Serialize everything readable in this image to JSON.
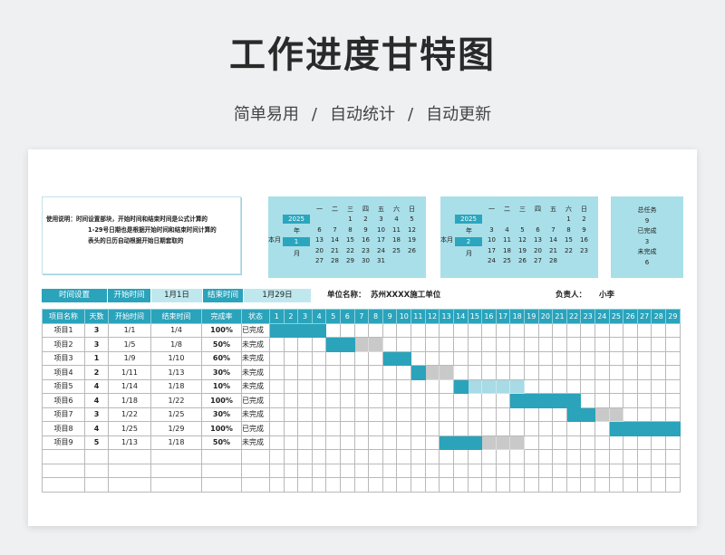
{
  "page": {
    "title": "工作进度甘特图",
    "subtitle_parts": [
      "简单易用",
      "自动统计",
      "自动更新"
    ],
    "separator": "/"
  },
  "note": {
    "line1": "使用说明：时间设置部块，开始时间和结束时间是公式计算的",
    "line2": "1-29号日期也是根据开始时间和结束时间计算的",
    "line3": "表头的日历自动根据开始日期套取的"
  },
  "calendars": [
    {
      "year": "2025",
      "year_label": "年",
      "month": "1",
      "month_label": "月",
      "side_label": "本月",
      "weekdays": [
        "一",
        "二",
        "三",
        "四",
        "五",
        "六",
        "日"
      ],
      "weeks": [
        [
          "",
          "",
          "1",
          "2",
          "3",
          "4",
          "5"
        ],
        [
          "6",
          "7",
          "8",
          "9",
          "10",
          "11",
          "12"
        ],
        [
          "13",
          "14",
          "15",
          "16",
          "17",
          "18",
          "19"
        ],
        [
          "20",
          "21",
          "22",
          "23",
          "24",
          "25",
          "26"
        ],
        [
          "27",
          "28",
          "29",
          "30",
          "31",
          "",
          ""
        ]
      ]
    },
    {
      "year": "2025",
      "year_label": "年",
      "month": "2",
      "month_label": "月",
      "side_label": "本月",
      "weekdays": [
        "一",
        "二",
        "三",
        "四",
        "五",
        "六",
        "日"
      ],
      "weeks": [
        [
          "",
          "",
          "",
          "",
          "",
          "1",
          "2"
        ],
        [
          "3",
          "4",
          "5",
          "6",
          "7",
          "8",
          "9"
        ],
        [
          "10",
          "11",
          "12",
          "13",
          "14",
          "15",
          "16"
        ],
        [
          "17",
          "18",
          "19",
          "20",
          "21",
          "22",
          "23"
        ],
        [
          "24",
          "25",
          "26",
          "27",
          "28",
          "",
          ""
        ]
      ]
    }
  ],
  "summary": {
    "total_label": "总任务",
    "total": "9",
    "done_label": "已完成",
    "done": "3",
    "undone_label": "未完成",
    "undone": "6"
  },
  "settings": {
    "time_label": "时间设置",
    "start_label": "开始时间",
    "start_value": "1月1日",
    "end_label": "结束时间",
    "end_value": "1月29日",
    "unit_label": "单位名称：",
    "unit_value": "苏州XXXX施工单位",
    "owner_label": "负责人：",
    "owner_value": "小李"
  },
  "table": {
    "headers": [
      "项目名称",
      "天数",
      "开始时间",
      "结束时间",
      "完成率",
      "状态"
    ],
    "day_numbers": [
      "1",
      "2",
      "3",
      "4",
      "5",
      "6",
      "7",
      "8",
      "9",
      "10",
      "11",
      "12",
      "13",
      "14",
      "15",
      "16",
      "17",
      "18",
      "19",
      "20",
      "21",
      "22",
      "23",
      "24",
      "25",
      "26",
      "27",
      "28",
      "29"
    ],
    "rows": [
      {
        "name": "项目1",
        "days": "3",
        "start": "1/1",
        "end": "1/4",
        "rate": "100%",
        "status": "已完成",
        "s": 1,
        "e": 4,
        "p": 1.0,
        "style": "done"
      },
      {
        "name": "项目2",
        "days": "3",
        "start": "1/5",
        "end": "1/8",
        "rate": "50%",
        "status": "未完成",
        "s": 5,
        "e": 8,
        "p": 0.5,
        "style": "rem"
      },
      {
        "name": "项目3",
        "days": "1",
        "start": "1/9",
        "end": "1/10",
        "rate": "60%",
        "status": "未完成",
        "s": 9,
        "e": 10,
        "p": 1.0,
        "style": "rem"
      },
      {
        "name": "项目4",
        "days": "2",
        "start": "1/11",
        "end": "1/13",
        "rate": "30%",
        "status": "未完成",
        "s": 11,
        "e": 13,
        "p": 0.34,
        "style": "rem"
      },
      {
        "name": "项目5",
        "days": "4",
        "start": "1/14",
        "end": "1/18",
        "rate": "10%",
        "status": "未完成",
        "s": 14,
        "e": 18,
        "p": 0.2,
        "style": "rem2"
      },
      {
        "name": "项目6",
        "days": "4",
        "start": "1/18",
        "end": "1/22",
        "rate": "100%",
        "status": "已完成",
        "s": 18,
        "e": 22,
        "p": 1.0,
        "style": "done"
      },
      {
        "name": "项目7",
        "days": "3",
        "start": "1/22",
        "end": "1/25",
        "rate": "30%",
        "status": "未完成",
        "s": 22,
        "e": 25,
        "p": 0.5,
        "style": "rem"
      },
      {
        "name": "项目8",
        "days": "4",
        "start": "1/25",
        "end": "1/29",
        "rate": "100%",
        "status": "已完成",
        "s": 25,
        "e": 29,
        "p": 1.0,
        "style": "done"
      },
      {
        "name": "项目9",
        "days": "5",
        "start": "1/13",
        "end": "1/18",
        "rate": "50%",
        "status": "未完成",
        "s": 13,
        "e": 18,
        "p": 0.5,
        "style": "rem"
      }
    ],
    "empty_rows": 3
  }
}
